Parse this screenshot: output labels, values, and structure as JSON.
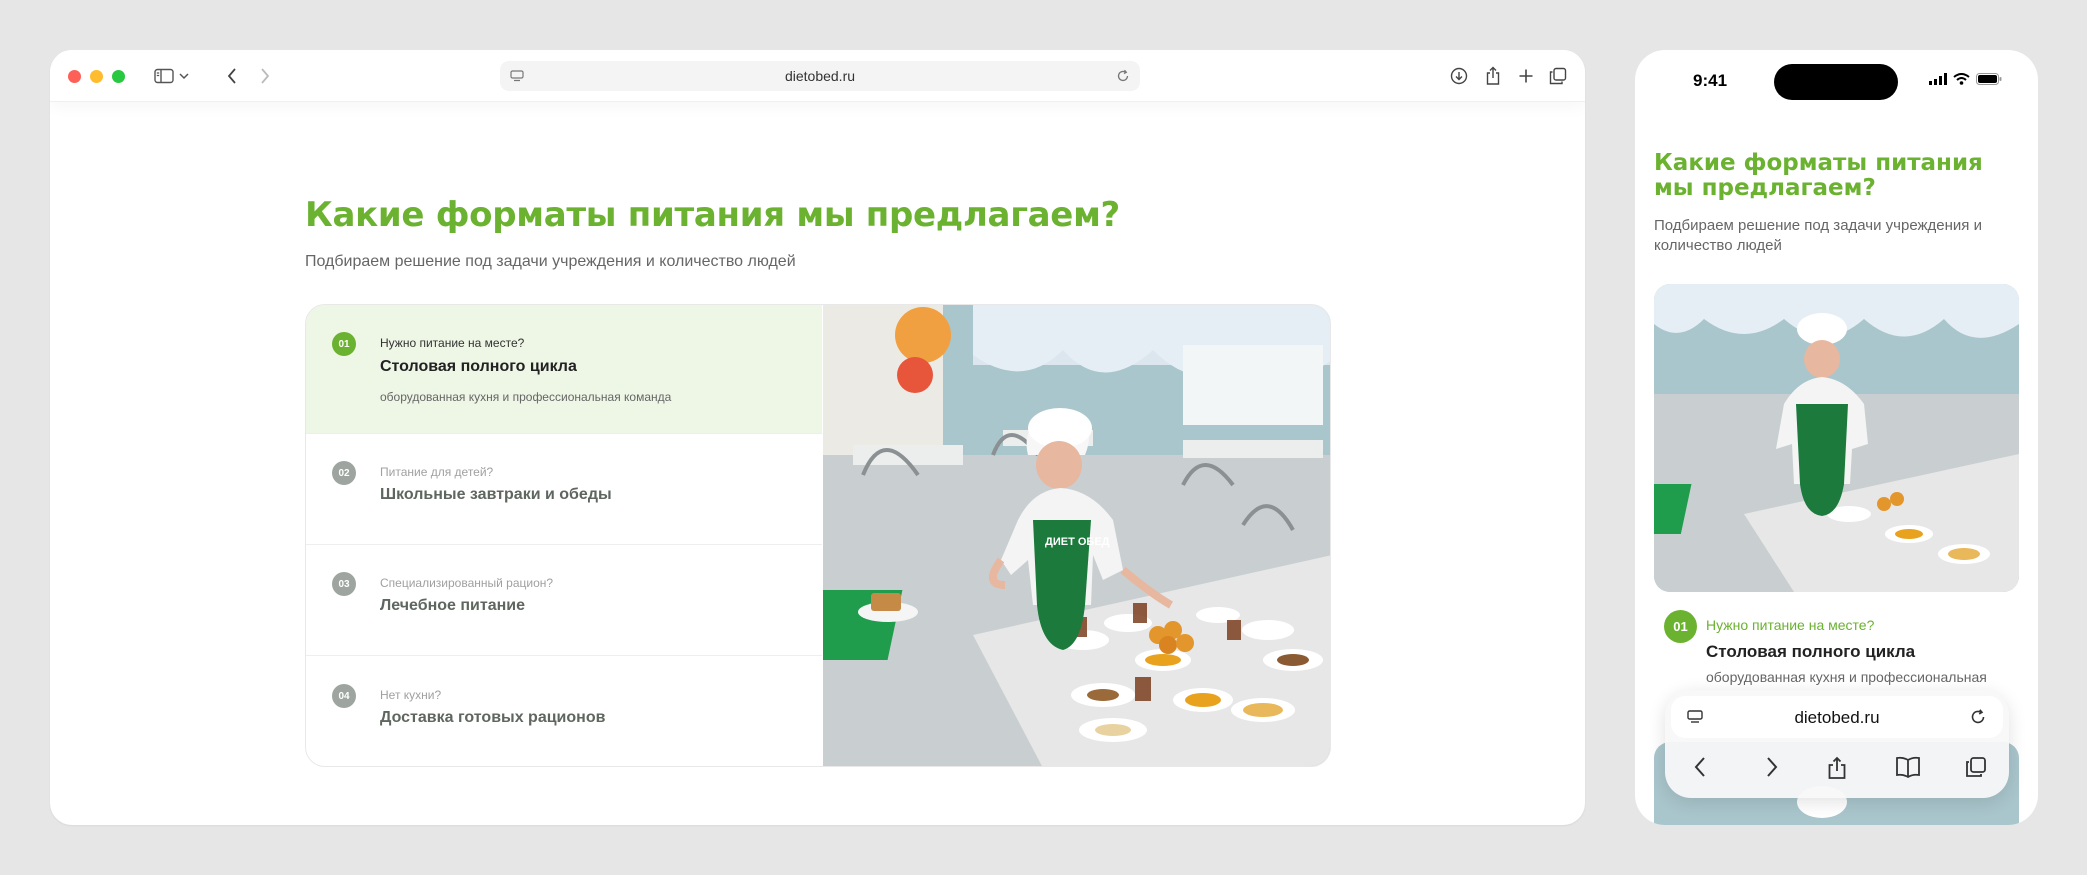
{
  "desktop": {
    "address": {
      "url": "dietobed.ru"
    },
    "section": {
      "title": "Какие форматы питания мы предлагаем?",
      "subtitle": "Подбираем решение под задачи учреждения и количество людей"
    },
    "options": [
      {
        "num": "01",
        "question": "Нужно питание на месте?",
        "title": "Столовая полного цикла",
        "desc": "оборудованная кухня и профессиональная команда",
        "active": true
      },
      {
        "num": "02",
        "question": "Питание для детей?",
        "title": "Школьные завтраки и обеды",
        "active": false
      },
      {
        "num": "03",
        "question": "Специализированный рацион?",
        "title": "Лечебное питание",
        "active": false
      },
      {
        "num": "04",
        "question": "Нет кухни?",
        "title": "Доставка готовых рационов",
        "active": false
      }
    ],
    "photo": {
      "apron_text": "ДИЕТ ОБЕД"
    }
  },
  "mobile": {
    "status_time": "9:41",
    "title": "Какие форматы питания мы предлагаем?",
    "subtitle": "Подбираем решение под задачи учреждения и количество людей",
    "option": {
      "num": "01",
      "question": "Нужно питание на месте?",
      "title": "Столовая полного цикла",
      "desc": "оборудованная кухня и профессиональная"
    },
    "url": "dietobed.ru"
  },
  "colors": {
    "accent": "#6ab230",
    "active_bg": "#eef6e6",
    "muted_badge": "#9ea5a0"
  },
  "icons": [
    "sidebar-icon",
    "chevron-down-icon",
    "back-icon",
    "forward-icon",
    "site-icon",
    "reload-icon",
    "download-icon",
    "share-icon",
    "plus-icon",
    "tabs-icon",
    "signal-icon",
    "wifi-icon",
    "battery-icon",
    "bookmarks-icon"
  ]
}
